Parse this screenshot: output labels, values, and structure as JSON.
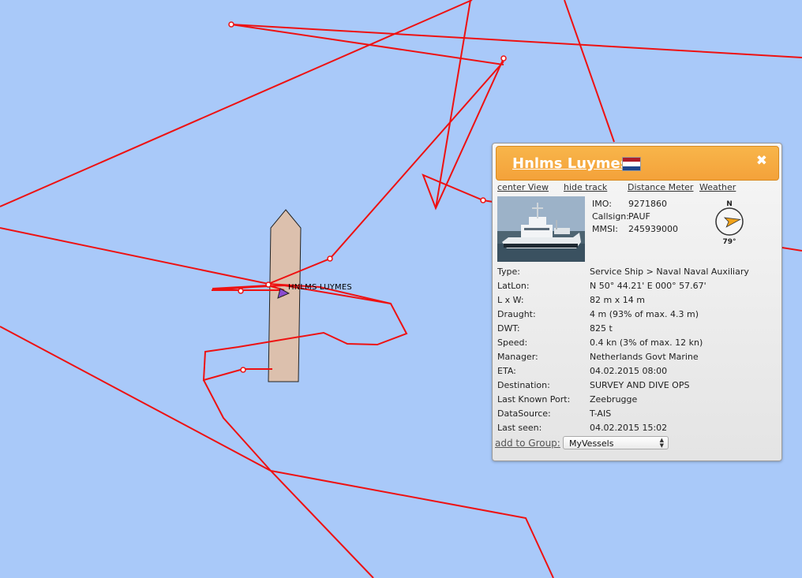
{
  "map": {
    "vessel_label": "HNLMS LUYMES",
    "track_color": "#ee1111",
    "sea_color": "#a9c9f9",
    "zone_color": "#dcc0ad"
  },
  "popup": {
    "title": "Hnlms Luymes",
    "flag": {
      "country": "Netherlands",
      "colors": [
        "#ae1c28",
        "#ffffff",
        "#21468b"
      ]
    },
    "close_icon": "close-icon",
    "links": {
      "center_view": "center View",
      "hide_track": "hide track",
      "distance_meter": "Distance Meter",
      "weather": "Weather"
    },
    "ids": {
      "imo_label": "IMO:",
      "imo": "9271860",
      "callsign_label": "Callsign:",
      "callsign": "PAUF",
      "mmsi_label": "MMSI:",
      "mmsi": "245939000"
    },
    "compass": {
      "north": "N",
      "heading_text": "79°",
      "heading_deg": 79
    },
    "details": [
      {
        "label": "Type:",
        "value": "Service Ship > Naval Naval Auxiliary"
      },
      {
        "label": "LatLon:",
        "value": "N 50° 44.21' E 000° 57.67'"
      },
      {
        "label": "L x W:",
        "value": "82 m x 14 m"
      },
      {
        "label": "Draught:",
        "value": "4 m (93% of max. 4.3 m)"
      },
      {
        "label": "DWT:",
        "value": "825 t"
      },
      {
        "label": "Speed:",
        "value": "0.4 kn (3% of max. 12 kn)"
      },
      {
        "label": "Manager:",
        "value": "Netherlands Govt Marine"
      },
      {
        "label": "ETA:",
        "value": "04.02.2015 08:00"
      },
      {
        "label": "Destination:",
        "value": "SURVEY AND DIVE OPS"
      },
      {
        "label": "Last Known Port:",
        "value": "Zeebrugge"
      },
      {
        "label": "DataSource:",
        "value": "T-AIS"
      },
      {
        "label": "Last seen:",
        "value": "04.02.2015 15:02"
      }
    ],
    "group": {
      "label": "add to Group:",
      "selected": "MyVessels"
    }
  }
}
